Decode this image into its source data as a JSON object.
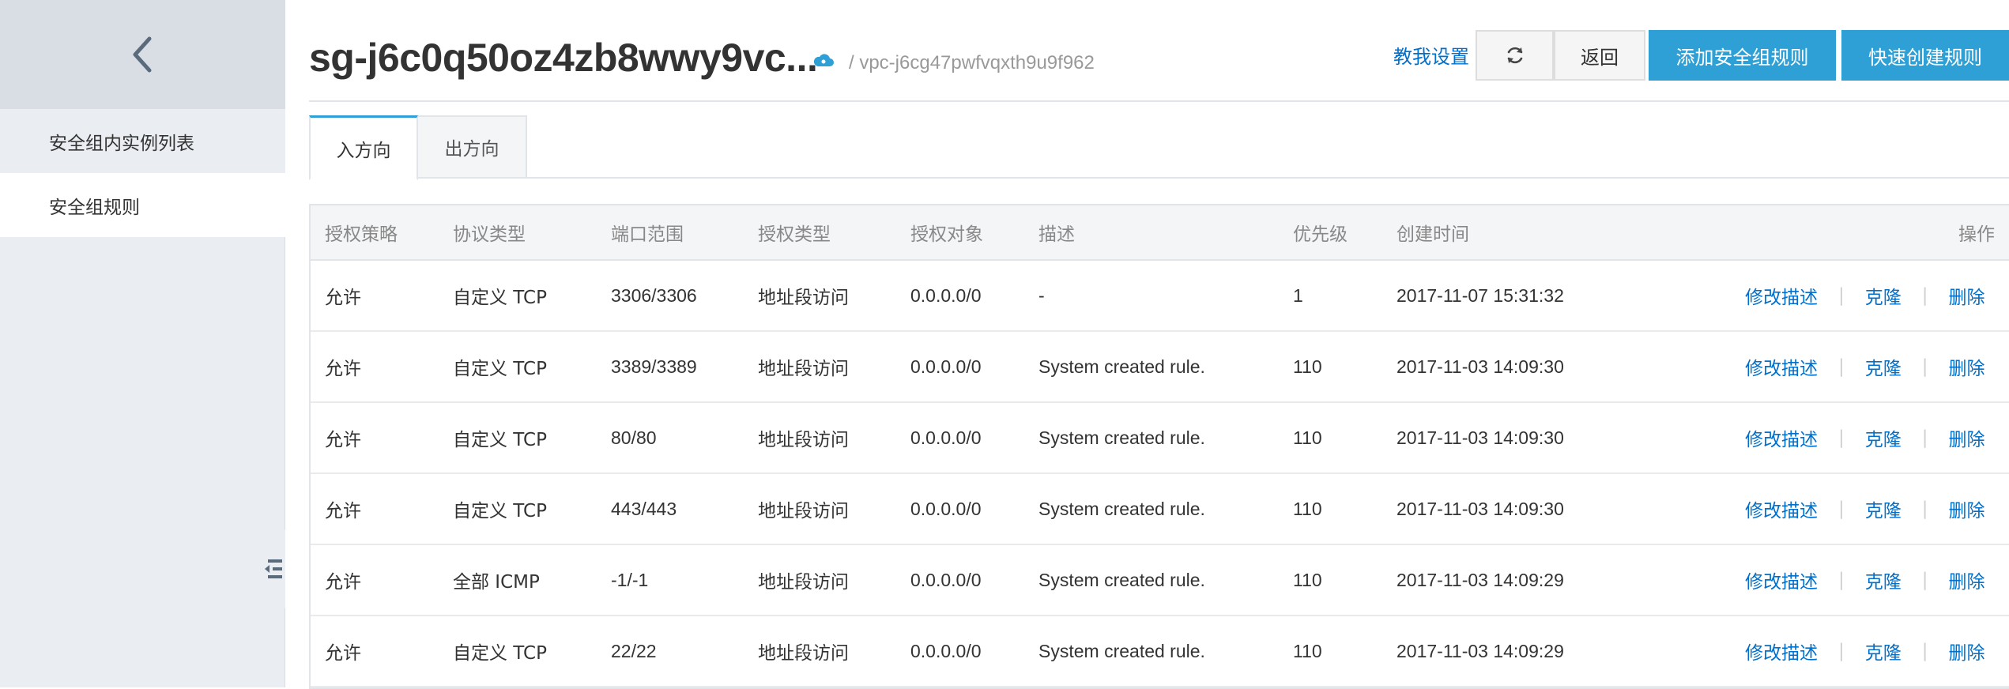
{
  "sidebar": {
    "back_icon": "chevron-left-icon",
    "items": [
      {
        "label": "安全组内实例列表"
      },
      {
        "label": "安全组规则"
      }
    ]
  },
  "header": {
    "title": "sg-j6c0q50oz4zb8wwy9vc...",
    "cloud_icon": "cloud-icon",
    "vpc": "/ vpc-j6cg47pwfvqxth9u9f962",
    "help_link": "教我设置",
    "refresh_icon": "refresh-icon",
    "back_label": "返回",
    "add_rule_label": "添加安全组规则",
    "quick_create_label": "快速创建规则"
  },
  "tabs": [
    {
      "label": "入方向",
      "active": true
    },
    {
      "label": "出方向",
      "active": false
    }
  ],
  "table": {
    "columns": [
      "授权策略",
      "协议类型",
      "端口范围",
      "授权类型",
      "授权对象",
      "描述",
      "优先级",
      "创建时间",
      "操作"
    ],
    "rows": [
      {
        "policy": "允许",
        "protocol": "自定义 TCP",
        "port": "3306/3306",
        "auth_type": "地址段访问",
        "object": "0.0.0.0/0",
        "desc": "-",
        "priority": "1",
        "created": "2017-11-07 15:31:32"
      },
      {
        "policy": "允许",
        "protocol": "自定义 TCP",
        "port": "3389/3389",
        "auth_type": "地址段访问",
        "object": "0.0.0.0/0",
        "desc": "System created rule.",
        "priority": "110",
        "created": "2017-11-03 14:09:30"
      },
      {
        "policy": "允许",
        "protocol": "自定义 TCP",
        "port": "80/80",
        "auth_type": "地址段访问",
        "object": "0.0.0.0/0",
        "desc": "System created rule.",
        "priority": "110",
        "created": "2017-11-03 14:09:30"
      },
      {
        "policy": "允许",
        "protocol": "自定义 TCP",
        "port": "443/443",
        "auth_type": "地址段访问",
        "object": "0.0.0.0/0",
        "desc": "System created rule.",
        "priority": "110",
        "created": "2017-11-03 14:09:30"
      },
      {
        "policy": "允许",
        "protocol": "全部 ICMP",
        "port": "-1/-1",
        "auth_type": "地址段访问",
        "object": "0.0.0.0/0",
        "desc": "System created rule.",
        "priority": "110",
        "created": "2017-11-03 14:09:29"
      },
      {
        "policy": "允许",
        "protocol": "自定义 TCP",
        "port": "22/22",
        "auth_type": "地址段访问",
        "object": "0.0.0.0/0",
        "desc": "System created rule.",
        "priority": "110",
        "created": "2017-11-03 14:09:29"
      }
    ],
    "actions": {
      "edit": "修改描述",
      "clone": "克隆",
      "delete": "删除",
      "separator": "|"
    }
  },
  "colors": {
    "accent": "#2fa0d5",
    "link": "#0070cc",
    "sidebar_bg": "#eaedf1"
  }
}
